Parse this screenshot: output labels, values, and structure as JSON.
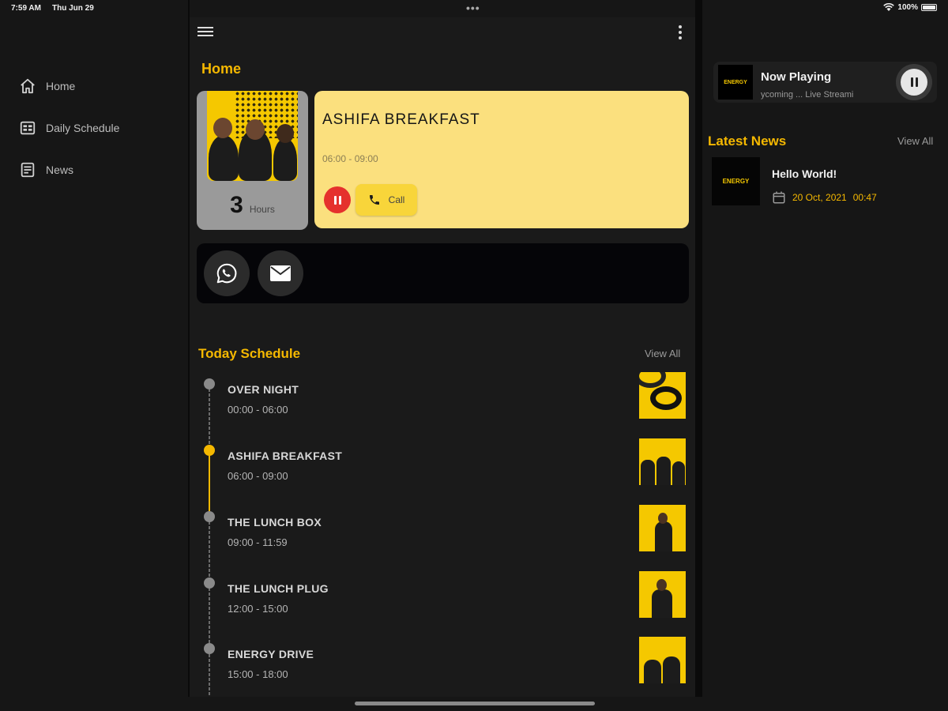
{
  "status_bar": {
    "time": "7:59 AM",
    "date": "Thu Jun 29",
    "battery": "100%"
  },
  "sidebar": {
    "items": [
      {
        "label": "Home",
        "icon": "home-icon"
      },
      {
        "label": "Daily Schedule",
        "icon": "schedule-icon"
      },
      {
        "label": "News",
        "icon": "news-icon"
      }
    ]
  },
  "main": {
    "page_title": "Home",
    "current_show": {
      "duration_number": "3",
      "duration_label": "Hours",
      "title": "ASHIFA BREAKFAST",
      "time": "06:00 - 09:00",
      "call_label": "Call"
    },
    "contact": {
      "whatsapp_icon": "whatsapp-icon",
      "email_icon": "mail-icon"
    },
    "schedule": {
      "title": "Today Schedule",
      "view_all": "View All",
      "items": [
        {
          "name": "OVER NIGHT",
          "time": "00:00 - 06:00"
        },
        {
          "name": "ASHIFA BREAKFAST",
          "time": "06:00 - 09:00",
          "active": true
        },
        {
          "name": "THE LUNCH BOX",
          "time": "09:00 - 11:59"
        },
        {
          "name": "THE LUNCH PLUG",
          "time": "12:00 - 15:00"
        },
        {
          "name": "ENERGY DRIVE",
          "time": "15:00 - 18:00"
        }
      ]
    }
  },
  "right": {
    "now_playing": {
      "title": "Now Playing",
      "subtitle": "ycoming ...     Live Streami",
      "logo_text": "ENERGY"
    },
    "latest_news": {
      "title": "Latest News",
      "view_all": "View All",
      "items": [
        {
          "title": "Hello World!",
          "date": "20 Oct, 2021",
          "time": "00:47",
          "thumb_text": "ENERGY"
        }
      ]
    }
  },
  "colors": {
    "accent": "#f5b800",
    "card_yellow": "#fbe07e",
    "pause_red": "#e5312d"
  }
}
